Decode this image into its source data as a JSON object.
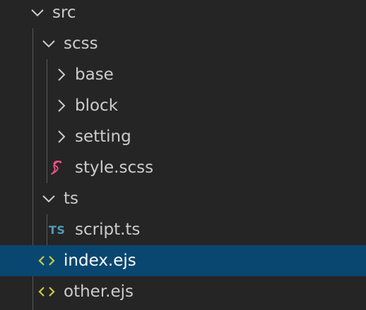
{
  "tree": {
    "src": {
      "label": "src",
      "icon": "chevron-down-icon"
    },
    "scss": {
      "label": "scss",
      "icon": "chevron-down-icon"
    },
    "base": {
      "label": "base",
      "icon": "chevron-right-icon"
    },
    "block": {
      "label": "block",
      "icon": "chevron-right-icon"
    },
    "setting": {
      "label": "setting",
      "icon": "chevron-right-icon"
    },
    "style_scss": {
      "label": "style.scss",
      "icon": "sass-icon"
    },
    "ts": {
      "label": "ts",
      "icon": "chevron-down-icon"
    },
    "script_ts": {
      "label": "script.ts",
      "icon": "typescript-icon",
      "icon_text": "TS"
    },
    "index_ejs": {
      "label": "index.ejs",
      "icon": "code-brackets-icon",
      "selected": true
    },
    "other_ejs": {
      "label": "other.ejs",
      "icon": "code-brackets-icon"
    }
  },
  "colors": {
    "background": "#252526",
    "selection": "#094771",
    "text": "#cccccc",
    "typescript": "#519aba",
    "sass": "#f55385",
    "ejs": "#cbcb41"
  }
}
